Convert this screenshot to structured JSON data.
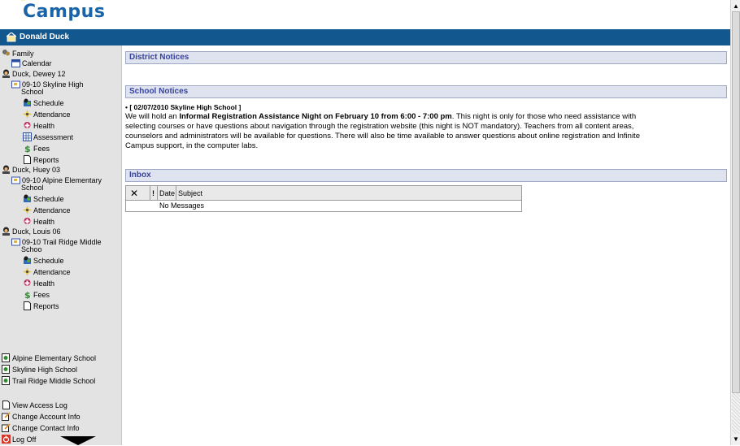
{
  "header": {
    "logo_text": "Campus",
    "user_name": "Donald Duck"
  },
  "sidebar": {
    "family_label": "Family",
    "calendar_label": "Calendar",
    "students": [
      {
        "name": "Duck, Dewey 12",
        "school_line1": "09-10 Skyline High",
        "school_line2": "School",
        "links": [
          "Schedule",
          "Attendance",
          "Health",
          "Assessment",
          "Fees",
          "Reports"
        ]
      },
      {
        "name": "Duck, Huey 03",
        "school_line1": "09-10 Alpine Elementary",
        "school_line2": "School",
        "links": [
          "Schedule",
          "Attendance",
          "Health"
        ]
      },
      {
        "name": "Duck, Louis 06",
        "school_line1": "09-10 Trail Ridge Middle",
        "school_line2": "Schoo",
        "links": [
          "Schedule",
          "Attendance",
          "Health",
          "Fees",
          "Reports"
        ]
      }
    ],
    "schools": [
      "Alpine Elementary School",
      "Skyline High School",
      "Trail Ridge Middle School"
    ],
    "account_links": [
      "View Access Log",
      "Change Account Info",
      "Change Contact Info",
      "Log Off"
    ]
  },
  "main": {
    "district_notices_title": "District Notices",
    "school_notices_title": "School Notices",
    "notice": {
      "bullet": "•",
      "heading": "[ 02/07/2010 Skyline High School ]",
      "intro": "We will hold an ",
      "bold_text": "Informal Registration Assistance Night on February 10 from 6:00 - 7:00 pm",
      "line1_rest": ". This night is only for those who need assistance with",
      "line2": "selecting courses or have questions about navigation through the registration website (this night is NOT mandatory). Teachers from all content areas,",
      "line3": "counselors and administrators will be available for questions. There will also be time available to answer questions about online registration and Infinite",
      "line4": "Campus support, in the computer labs."
    },
    "inbox_title": "Inbox",
    "inbox": {
      "col_delete": "✕",
      "col_priority": "!",
      "col_date": "Date",
      "col_subject": "Subject",
      "empty_text": "No Messages"
    }
  },
  "colors": {
    "title_bar": "#13578f",
    "section_bg": "#dfe3f0",
    "section_text": "#38439a",
    "sidebar_bg": "#e3e3e3"
  },
  "icons": {
    "calendar": "calendar-icon",
    "student": "student-icon",
    "school": "school-icon",
    "schedule": "schedule-icon",
    "attendance": "attendance-icon",
    "health": "health-icon",
    "assessment": "assessment-icon",
    "fees": "dollar-icon",
    "reports": "document-icon",
    "logoff": "power-icon"
  }
}
